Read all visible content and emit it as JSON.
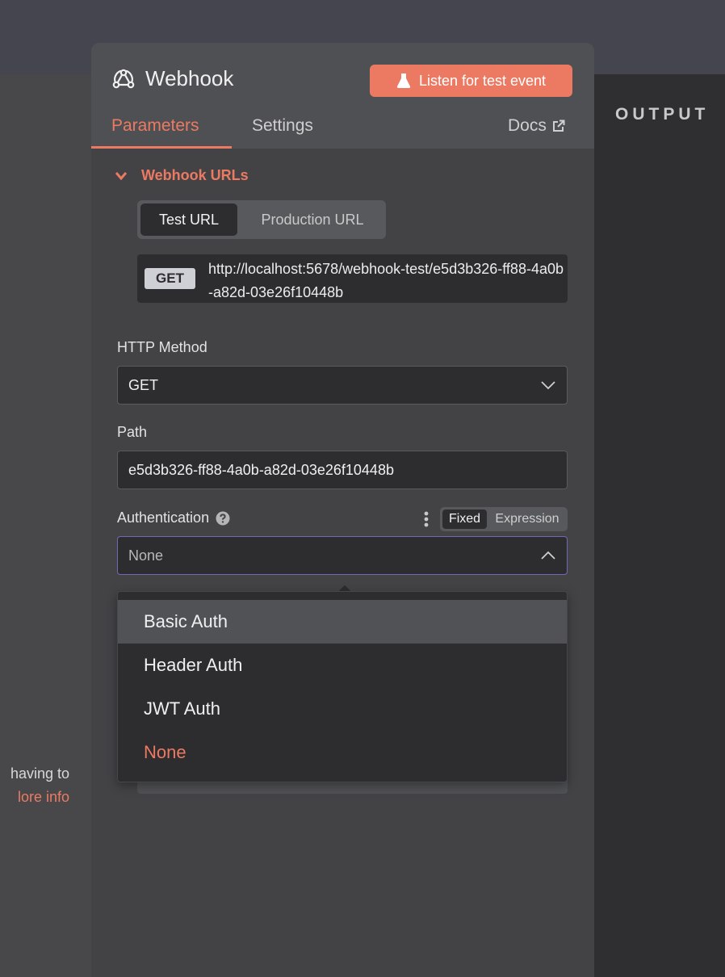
{
  "node": {
    "title": "Webhook",
    "icon": "webhook-icon",
    "listen_button": "Listen for test event"
  },
  "tabs": {
    "parameters": "Parameters",
    "settings": "Settings",
    "docs": "Docs"
  },
  "output_label": "OUTPUT",
  "webhook_urls": {
    "section_title": "Webhook URLs",
    "tabs": [
      "Test URL",
      "Production URL"
    ],
    "active_tab": "Test URL",
    "method": "GET",
    "url": "http://localhost:5678/webhook-test/e5d3b326-ff88-4a0b-a82d-03e26f10448b"
  },
  "fields": {
    "http_method": {
      "label": "HTTP Method",
      "value": "GET"
    },
    "path": {
      "label": "Path",
      "value": "e5d3b326-ff88-4a0b-a82d-03e26f10448b"
    },
    "authentication": {
      "label": "Authentication",
      "value": "None",
      "mode_fixed": "Fixed",
      "mode_expression": "Expression",
      "options": [
        "Basic Auth",
        "Header Auth",
        "JWT Auth",
        "None"
      ]
    }
  },
  "left_panel": {
    "text_line": "having to",
    "link_text": "lore info"
  },
  "colors": {
    "accent": "#ec7a63",
    "panel": "#434346",
    "input_bg": "#2d2d2f",
    "focus_border": "#6f6ab8"
  }
}
